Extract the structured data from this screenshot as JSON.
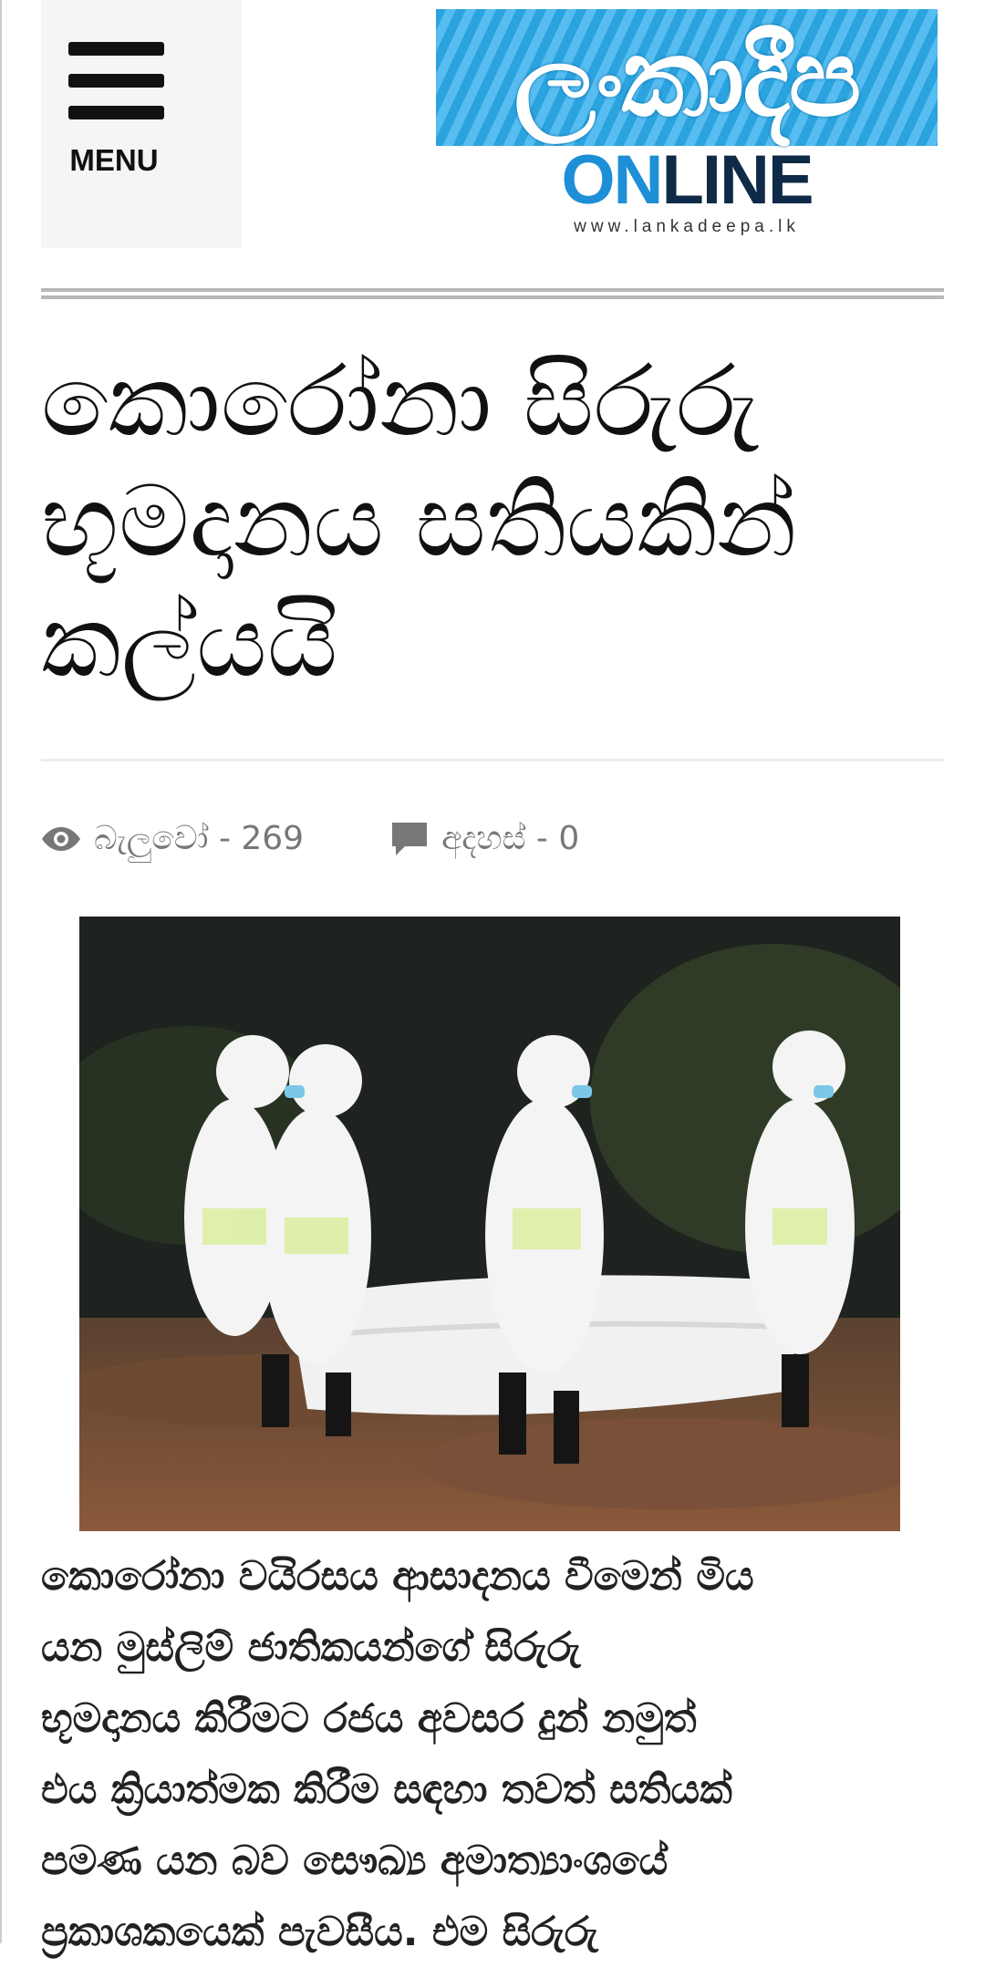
{
  "header": {
    "menu_label": "MENU",
    "logo": {
      "script_text": "ලංකාදීප",
      "online_on": "ON",
      "online_line": "LINE",
      "url": "www.lankadeepa.lk"
    }
  },
  "article": {
    "title_lines": [
      "කොරෝනා සිරුරු",
      "භූමදානය සතියකින්",
      "කල්යයි"
    ],
    "views_label": "බැලුවෝ - 269",
    "comments_label": "අදහස් - 0",
    "body_lines": [
      "කොරෝනා වයිරසය ආසාදනය වීමෙන් මිය",
      "යන මුස්ලිම් ජාතිකයන්ගේ සිරුරු",
      "භූමදානය කිරීමට රජය අවසර දුන් නමුත්",
      "එය ක්‍රියාත්මක කිරීම සඳහා තවත් සතියක්",
      "පමණ යන බව සෞඛ්‍ය අමාත්‍යාංශයේ",
      "ප්‍රකාශකයෙක් පැවසීය. එම සිරුරු"
    ]
  },
  "colors": {
    "logo_blue": "#2aa3df",
    "online_on": "#1d8fd6",
    "online_line": "#0f2a47",
    "meta_grey": "#777777"
  },
  "icons": {
    "menu": "hamburger-icon",
    "views": "eye-icon",
    "comments": "comment-icon"
  }
}
